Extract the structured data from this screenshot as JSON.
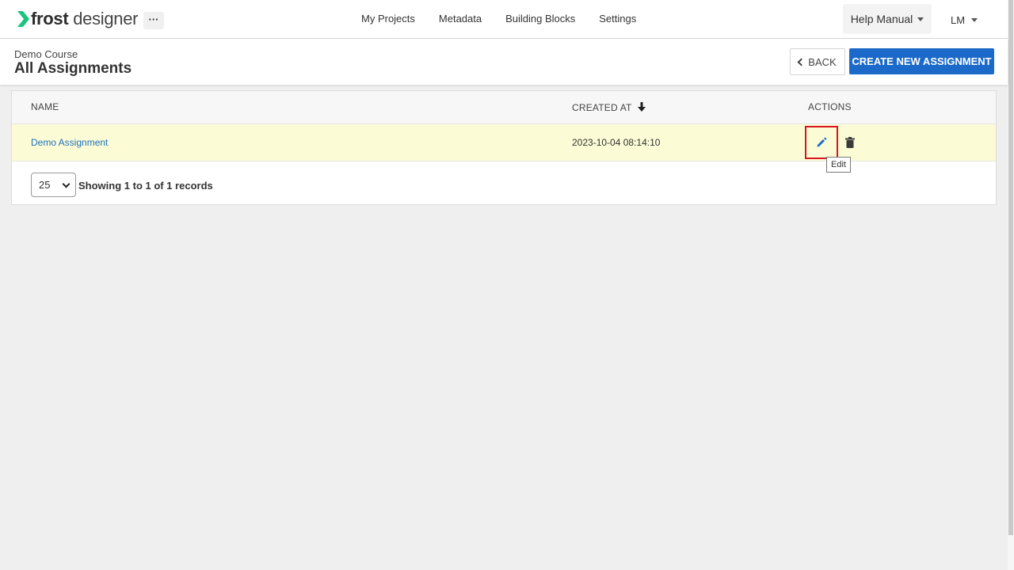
{
  "app": {
    "logo_bold": "frost",
    "logo_light": "designer",
    "more_label": "···"
  },
  "nav": {
    "items": [
      {
        "label": "My Projects"
      },
      {
        "label": "Metadata"
      },
      {
        "label": "Building Blocks"
      },
      {
        "label": "Settings"
      }
    ],
    "help_label": "Help Manual",
    "user_initials": "LM"
  },
  "header": {
    "breadcrumb": "Demo Course",
    "title": "All Assignments",
    "back_label": "BACK",
    "create_label": "CREATE NEW ASSIGNMENT"
  },
  "table": {
    "columns": [
      {
        "label": "NAME"
      },
      {
        "label": "CREATED AT"
      },
      {
        "label": "ACTIONS"
      }
    ],
    "rows": [
      {
        "name": "Demo Assignment",
        "created_at": "2023-10-04 08:14:10"
      }
    ],
    "tooltip": "Edit",
    "page_size": "25",
    "records_info": "Showing 1 to 1 of 1 records"
  },
  "colors": {
    "accent": "#1b6ac9",
    "logo_green": "#1bc47d",
    "row_highlight": "#fbfcd6",
    "focus_outline": "#d8141c"
  }
}
